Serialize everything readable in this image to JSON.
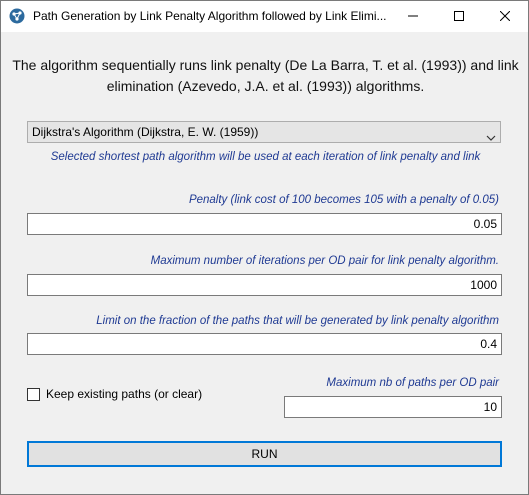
{
  "window": {
    "title": "Path Generation by Link Penalty Algorithm followed by Link Elimi..."
  },
  "description": "The algorithm sequentially runs link penalty (De La Barra, T. et al. (1993)) and link elimination (Azevedo, J.A. et al. (1993)) algorithms.",
  "algorithm_select": {
    "value": "Dijkstra's Algorithm (Dijkstra, E. W. (1959))",
    "hint": "Selected shortest path algorithm will be used at each iteration of link penalty and link"
  },
  "penalty": {
    "label": "Penalty (link cost of 100 becomes 105 with a penalty of 0.05)",
    "value": "0.05"
  },
  "max_iterations": {
    "label": "Maximum number of iterations per OD pair for link penalty algorithm.",
    "value": "1000"
  },
  "fraction_limit": {
    "label": "Limit on the fraction of the paths that will be generated by link penalty algorithm",
    "value": "0.4"
  },
  "keep_paths": {
    "label": "Keep existing paths (or clear)",
    "checked": false
  },
  "max_paths": {
    "label": "Maximum nb of paths per OD pair",
    "value": "10"
  },
  "run_button": {
    "label": "RUN"
  },
  "colors": {
    "hint_text": "#1f3a93",
    "button_focus_border": "#0078d7"
  },
  "icons": {
    "app": "network-graph-icon",
    "minimize": "minimize-icon",
    "maximize": "maximize-icon",
    "close": "close-icon",
    "dropdown": "chevron-down-icon"
  }
}
